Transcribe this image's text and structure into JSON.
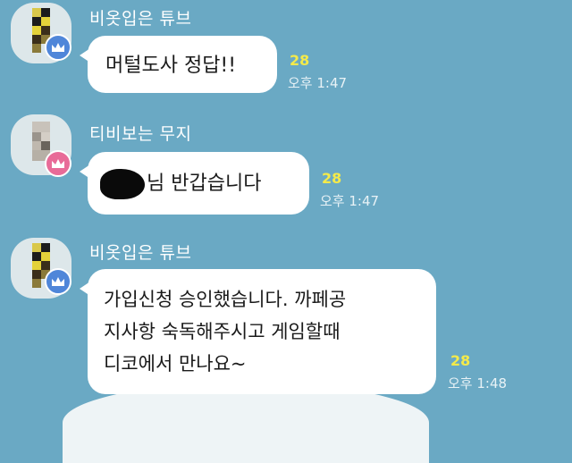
{
  "messages": [
    {
      "sender": "비옷입은 튜브",
      "text": "머털도사 정답!!",
      "unread": "28",
      "time": "오후 1:47",
      "badge": "crown-icon"
    },
    {
      "sender": "티비보는 무지",
      "text": "님 반갑습니다",
      "unread": "28",
      "time": "오후 1:47",
      "badge": "crown-icon"
    },
    {
      "sender": "비옷입은 튜브",
      "lines": [
        "가입신청 승인했습니다. 까페공",
        "지사항 숙독해주시고 게임할때",
        "디코에서 만나요~"
      ],
      "unread": "28",
      "time": "오후 1:48",
      "badge": "crown-icon"
    }
  ],
  "colors": {
    "background": "#6aa9c4",
    "bubble": "#ffffff",
    "unread": "#f4ea4a",
    "badge_blue": "#4f86d9",
    "badge_pink": "#e86b98"
  }
}
